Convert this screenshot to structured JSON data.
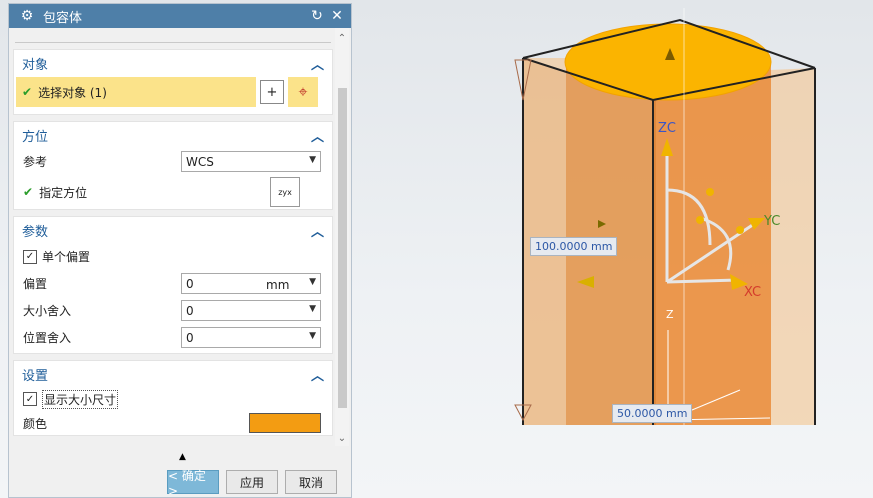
{
  "dialog": {
    "title": "包容体",
    "sections": {
      "object": {
        "title": "对象",
        "select_label": "选择对象 (1)"
      },
      "orientation": {
        "title": "方位",
        "ref_label": "参考",
        "ref_value": "WCS",
        "specify_label": "指定方位"
      },
      "params": {
        "title": "参数",
        "single_offset_label": "单个偏置",
        "offset_label": "偏置",
        "offset_value": "0",
        "offset_unit": "mm",
        "size_round_label": "大小舍入",
        "size_round_value": "0",
        "pos_round_label": "位置舍入",
        "pos_round_value": "0"
      },
      "settings": {
        "title": "设置",
        "show_size_label": "显示大小尺寸",
        "color_label": "颜色",
        "color": "#f39c12"
      }
    },
    "buttons": {
      "ok": "< 确定 >",
      "apply": "应用",
      "cancel": "取消"
    }
  },
  "viewport": {
    "dim_height": "100.0000 mm",
    "dim_width": "50.0000 mm",
    "axis_zc": "ZC",
    "axis_yc": "YC",
    "axis_xc": "XC",
    "axis_z": "Z"
  }
}
